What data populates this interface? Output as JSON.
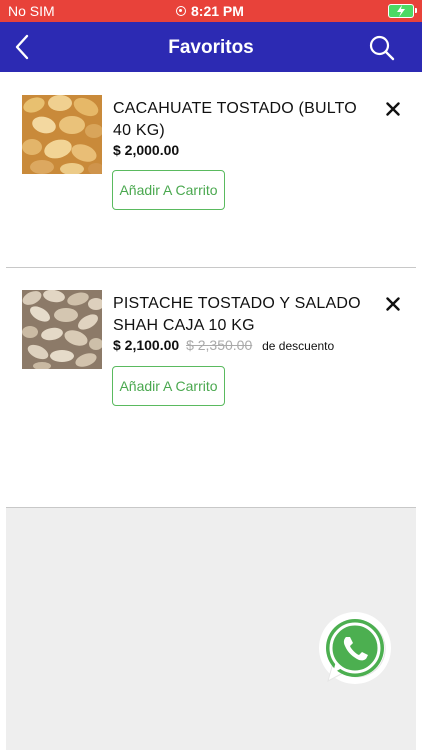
{
  "status_bar": {
    "carrier": "No SIM",
    "time": "8:21 PM"
  },
  "header": {
    "title": "Favoritos"
  },
  "items": [
    {
      "name": "CACAHUATE TOSTADO (BULTO 40 KG)",
      "price": "$ 2,000.00",
      "cart_label": "Añadir A Carrito"
    },
    {
      "name": "PISTACHE TOSTADO Y SALADO SHAH CAJA 10 KG",
      "price": "$ 2,100.00",
      "old_price": "$ 2,350.00",
      "discount_label": "de descuento",
      "cart_label": "Añadir A Carrito"
    }
  ],
  "colors": {
    "status_bar": "#e8423a",
    "nav_bar": "#2c2ab3",
    "accent_green": "#4aa84f"
  }
}
